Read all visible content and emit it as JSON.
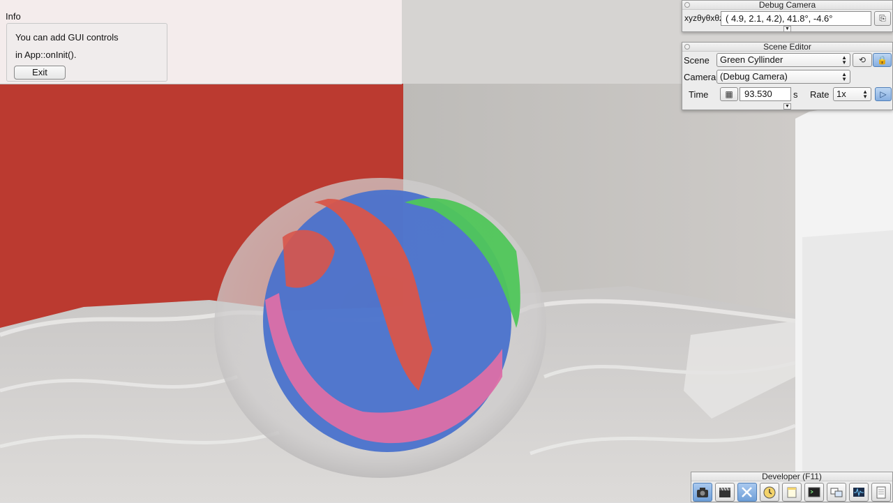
{
  "info": {
    "title": "Info",
    "line1": "You can add GUI controls",
    "line2": "in App::onInit().",
    "exit_label": "Exit"
  },
  "debug_camera": {
    "title": "Debug Camera",
    "coords_label": "xyzθyθxθz",
    "coords_value": "(  4.9,   2.1,   4.2),  41.8°,  -4.6°"
  },
  "scene_editor": {
    "title": "Scene Editor",
    "scene_label": "Scene",
    "scene_value": "Green Cyllinder",
    "camera_label": "Camera",
    "camera_value": "(Debug Camera)",
    "time_label": "Time",
    "time_value": "93.530",
    "time_unit": "s",
    "rate_label": "Rate",
    "rate_value": "1x"
  },
  "developer": {
    "title": "Developer (F11)",
    "tools": [
      "camera-icon",
      "film-clapper-icon",
      "tools-icon",
      "clock-icon",
      "note-icon",
      "terminal-icon",
      "window-icon",
      "waveform-icon",
      "document-icon"
    ]
  },
  "colors": {
    "red_wall": "#bb3a30",
    "sphere_blue": "#4a72cc",
    "sphere_red": "#d8554a",
    "sphere_pink": "#dc6fa6",
    "sphere_green": "#4fc65a"
  }
}
